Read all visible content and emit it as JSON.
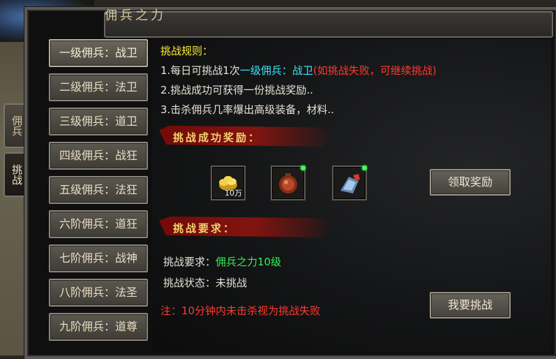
{
  "window": {
    "title": "佣兵之力"
  },
  "side_tabs": [
    {
      "label": "佣兵",
      "active": false
    },
    {
      "label": "挑战",
      "active": true
    }
  ],
  "levels": [
    {
      "label": "一级佣兵：战卫",
      "selected": true
    },
    {
      "label": "二级佣兵：法卫",
      "selected": false
    },
    {
      "label": "三级佣兵：道卫",
      "selected": false
    },
    {
      "label": "四级佣兵：战狂",
      "selected": false
    },
    {
      "label": "五级佣兵：法狂",
      "selected": false
    },
    {
      "label": "六阶佣兵：道狂",
      "selected": false
    },
    {
      "label": "七阶佣兵：战神",
      "selected": false
    },
    {
      "label": "八阶佣兵：法圣",
      "selected": false
    },
    {
      "label": "九阶佣兵：道尊",
      "selected": false
    }
  ],
  "rules": {
    "title": "挑战规则：",
    "line1_a": "1.每日可挑战1次",
    "line1_b": "一级佣兵：",
    "line1_c": "战卫",
    "line1_d": "(如挑战失败，可继续挑战)",
    "line2": "2.挑战成功可获得一份挑战奖励..",
    "line3": "3.击杀佣兵几率爆出高级装备，材料.."
  },
  "reward": {
    "banner": "挑战成功奖励：",
    "items": [
      {
        "icon": "gold-ingots-icon",
        "qty": "10万"
      },
      {
        "icon": "red-pouch-icon",
        "qty": ""
      },
      {
        "icon": "blue-gauntlet-icon",
        "qty": ""
      }
    ],
    "claim_label": "领取奖励"
  },
  "requirement": {
    "banner": "挑战要求：",
    "req_label": "挑战要求：",
    "req_value": "佣兵之力10级",
    "status_label": "挑战状态：",
    "status_value": "未挑战",
    "note": "注：10分钟内未击杀视为挑战失败",
    "challenge_label": "我要挑战"
  },
  "colors": {
    "rule_title": "#ffef33",
    "highlight_cyan": "#36e6ff",
    "warning_red": "#ff3a2e",
    "success_green": "#35ef57"
  }
}
